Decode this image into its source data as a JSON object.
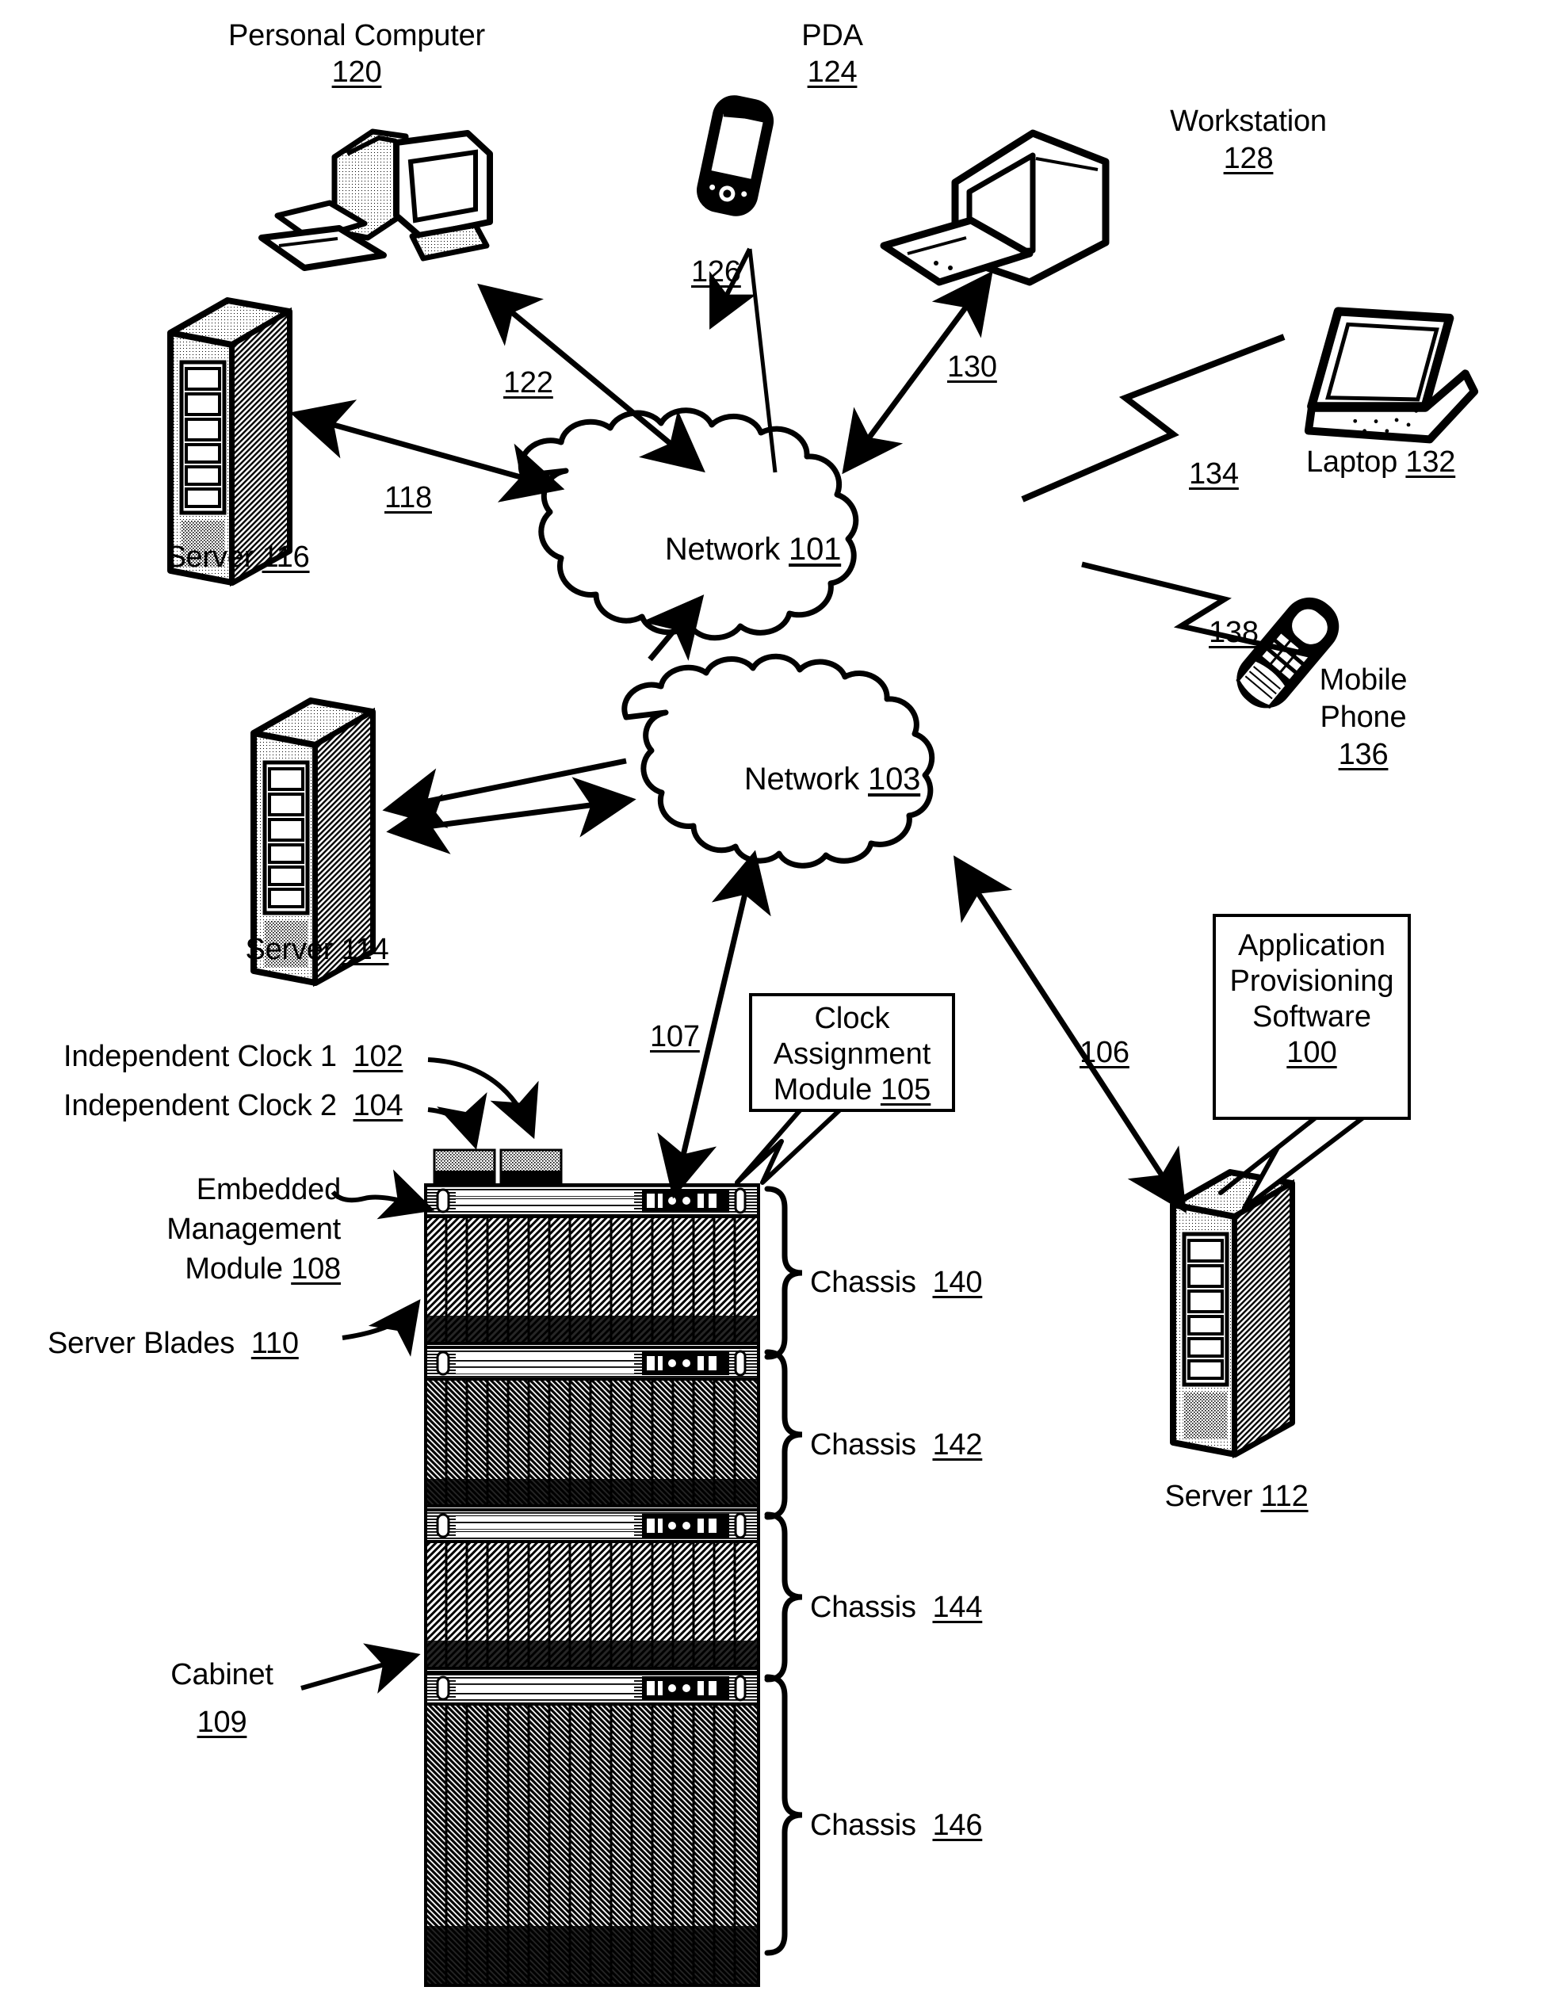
{
  "figure": {
    "type": "patent-network-diagram",
    "background": "#ffffff",
    "ink": "#000000"
  },
  "devices": {
    "personal_computer": {
      "label": "Personal Computer",
      "ref": "120",
      "icon": "desktop-computer-icon"
    },
    "pda": {
      "label": "PDA",
      "ref": "124",
      "icon": "pda-icon"
    },
    "workstation": {
      "label": "Workstation",
      "ref": "128",
      "icon": "workstation-icon"
    },
    "laptop": {
      "label": "Laptop",
      "ref": "132",
      "icon": "laptop-icon"
    },
    "mobile_phone": {
      "label_line1": "Mobile",
      "label_line2": "Phone",
      "ref": "136",
      "icon": "mobile-phone-icon"
    },
    "server_116": {
      "label": "Server",
      "ref": "116",
      "icon": "tower-server-icon"
    },
    "server_114": {
      "label": "Server",
      "ref": "114",
      "icon": "tower-server-icon"
    },
    "server_112": {
      "label": "Server",
      "ref": "112",
      "icon": "tower-server-icon"
    }
  },
  "networks": {
    "network_101": {
      "label": "Network",
      "ref": "101",
      "icon": "cloud-icon"
    },
    "network_103": {
      "label": "Network",
      "ref": "103",
      "icon": "cloud-icon"
    }
  },
  "links": {
    "link_118": "118",
    "link_122": "122",
    "link_126": "126",
    "link_130": "130",
    "link_134": "134",
    "link_138": "138",
    "link_106": "106",
    "link_107": "107"
  },
  "callouts": {
    "clock_assignment_module": {
      "line1": "Clock",
      "line2": "Assignment",
      "line3": "Module",
      "ref": "105"
    },
    "application_provisioning_software": {
      "line1": "Application",
      "line2": "Provisioning",
      "line3": "Software",
      "ref": "100"
    }
  },
  "annotations": {
    "independent_clock_1": {
      "label": "Independent Clock 1",
      "ref": "102"
    },
    "independent_clock_2": {
      "label": "Independent Clock 2",
      "ref": "104"
    },
    "embedded_management_module": {
      "line1": "Embedded",
      "line2": "Management",
      "line3": "Module",
      "ref": "108"
    },
    "server_blades": {
      "label": "Server Blades",
      "ref": "110"
    },
    "cabinet": {
      "label": "Cabinet",
      "ref": "109"
    }
  },
  "chassis_list": [
    {
      "label": "Chassis",
      "ref": "140"
    },
    {
      "label": "Chassis",
      "ref": "142"
    },
    {
      "label": "Chassis",
      "ref": "144"
    },
    {
      "label": "Chassis",
      "ref": "146"
    }
  ]
}
